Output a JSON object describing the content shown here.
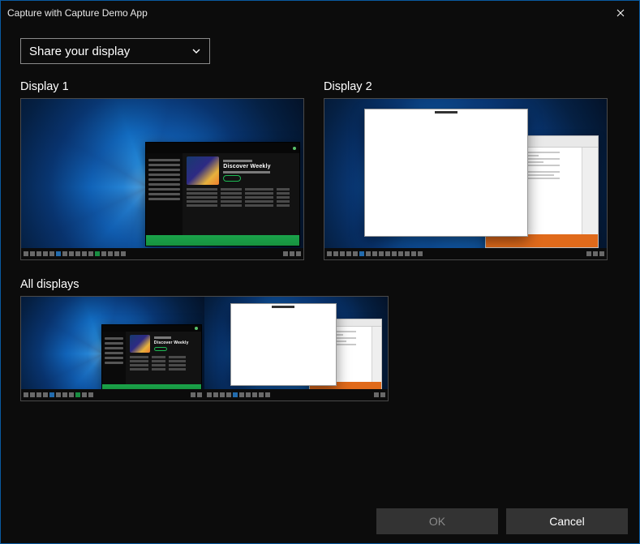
{
  "window": {
    "title": "Capture with Capture Demo App"
  },
  "dropdown": {
    "label": "Share your display"
  },
  "options": {
    "display1": {
      "label": "Display 1"
    },
    "display2": {
      "label": "Display 2"
    },
    "all": {
      "label": "All displays"
    }
  },
  "spotify": {
    "title": "Discover Weekly"
  },
  "footer": {
    "ok": "OK",
    "cancel": "Cancel"
  }
}
